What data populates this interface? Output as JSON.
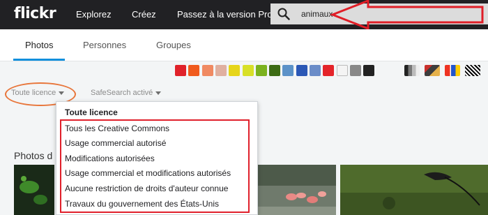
{
  "app": {
    "logo": "flickr"
  },
  "nav": {
    "explore": "Explorez",
    "create": "Créez",
    "pro": "Passez à la version Pro"
  },
  "search": {
    "value": "animaux"
  },
  "tabs": {
    "photos": "Photos",
    "people": "Personnes",
    "groups": "Groupes"
  },
  "colors": [
    "#e0222a",
    "#f05a1d",
    "#f08a62",
    "#e0b0a0",
    "#e6d51a",
    "#d8e028",
    "#7bb21e",
    "#3c6b14",
    "#5c92c8",
    "#2b58b6",
    "#6a8cc8",
    "#e4242a",
    "#f4f4f4",
    "#888888",
    "#222222"
  ],
  "textures": [
    "gray-scale-texture",
    "mixed-texture",
    "mondrian-texture",
    "black-white-pattern"
  ],
  "filters": {
    "license": "Toute licence",
    "safesearch": "SafeSearch activé"
  },
  "license_menu": {
    "header": "Toute licence",
    "items": [
      "Tous les Creative Commons",
      "Usage commercial autorisé",
      "Modifications autorisées",
      "Usage commercial et modifications autorisés",
      "Aucune restriction de droits d'auteur connue",
      "Travaux du gouvernement des États-Unis"
    ]
  },
  "results": {
    "title": "Photos d"
  }
}
